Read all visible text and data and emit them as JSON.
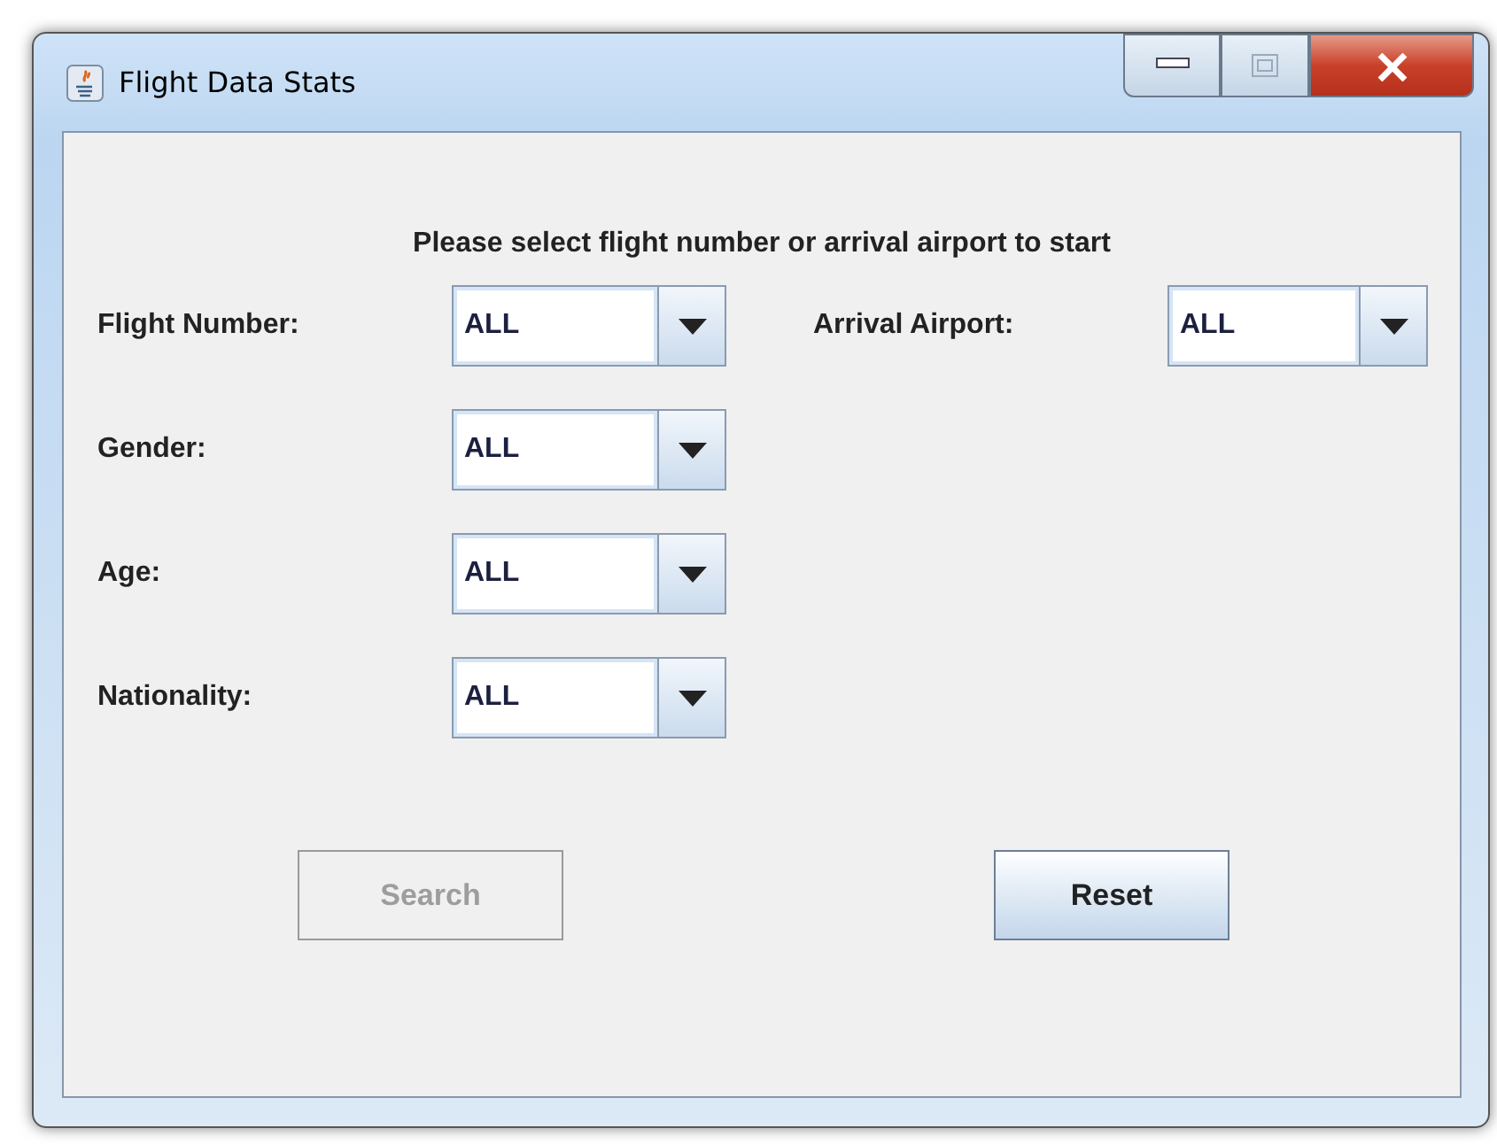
{
  "window": {
    "title": "Flight Data Stats"
  },
  "message": "Please select flight number or arrival airport to start",
  "fields": [
    {
      "label": "Flight Number:",
      "value": "ALL"
    },
    {
      "label": "Gender:",
      "value": "ALL"
    },
    {
      "label": "Age:",
      "value": "ALL"
    },
    {
      "label": "Nationality:",
      "value": "ALL"
    }
  ],
  "arrival": {
    "label": "Arrival Airport:",
    "value": "ALL"
  },
  "buttons": [
    {
      "label": "Search",
      "disabled": true
    },
    {
      "label": "Reset",
      "disabled": false
    }
  ]
}
